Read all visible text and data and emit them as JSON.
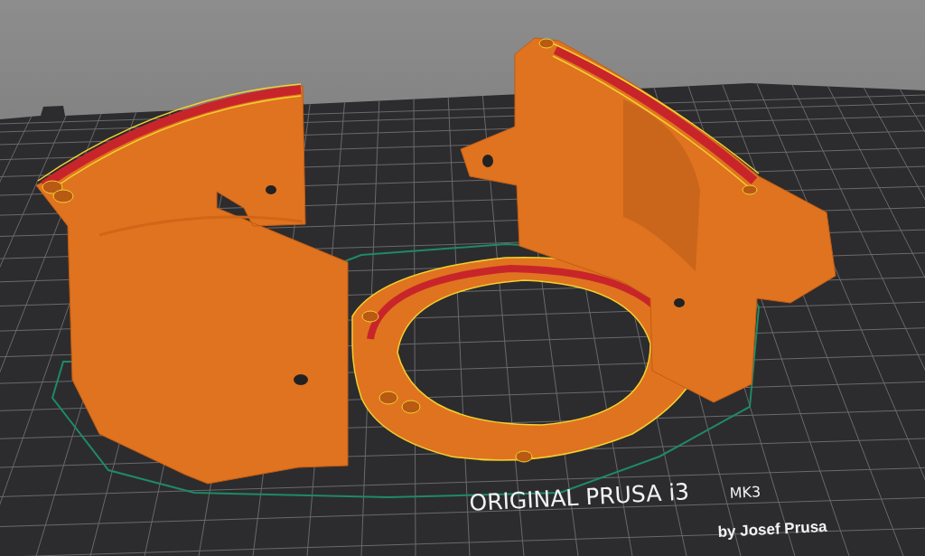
{
  "bed": {
    "logo": {
      "title": "ORIGINAL PRUSA i3",
      "model": "MK3",
      "byline": "by Josef Prusa"
    }
  }
}
